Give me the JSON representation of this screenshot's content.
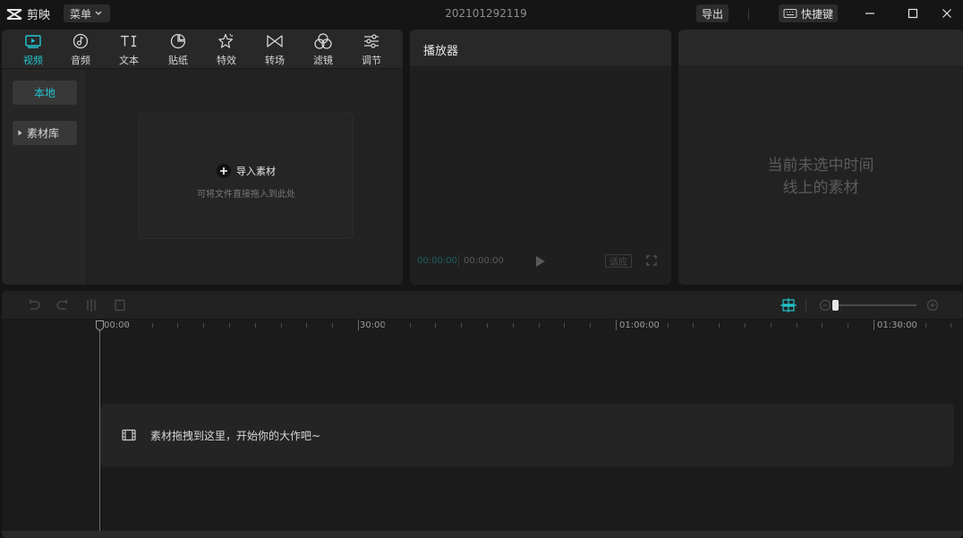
{
  "app": {
    "name": "剪映",
    "project_title": "202101292119"
  },
  "titlebar": {
    "menu_label": "菜单",
    "export_label": "导出",
    "shortcut_label": "快捷键"
  },
  "media": {
    "tabs": [
      {
        "label": "视频",
        "icon": "video-icon",
        "active": true
      },
      {
        "label": "音频",
        "icon": "audio-icon"
      },
      {
        "label": "文本",
        "icon": "text-icon"
      },
      {
        "label": "贴纸",
        "icon": "sticker-icon"
      },
      {
        "label": "特效",
        "icon": "effects-icon"
      },
      {
        "label": "转场",
        "icon": "transition-icon"
      },
      {
        "label": "滤镜",
        "icon": "filter-icon"
      },
      {
        "label": "调节",
        "icon": "adjust-icon"
      }
    ],
    "sidebar": {
      "local": "本地",
      "library": "素材库"
    },
    "import_label": "导入素材",
    "import_hint": "可将文件直接拖入到此处"
  },
  "player": {
    "title": "播放器",
    "current_time": "00:00:00",
    "total_time": "00:00:00",
    "ratio_label": "适应"
  },
  "properties": {
    "empty_line1": "当前未选中时间",
    "empty_line2": "线上的素材"
  },
  "timeline": {
    "ruler_labels": [
      "00:00",
      "30:00",
      "01:00:00",
      "01:30:00"
    ],
    "drop_hint": "素材拖拽到这里，开始你的大作吧~"
  },
  "colors": {
    "accent": "#22c6cf",
    "background": "#151515",
    "panel": "#222222"
  }
}
